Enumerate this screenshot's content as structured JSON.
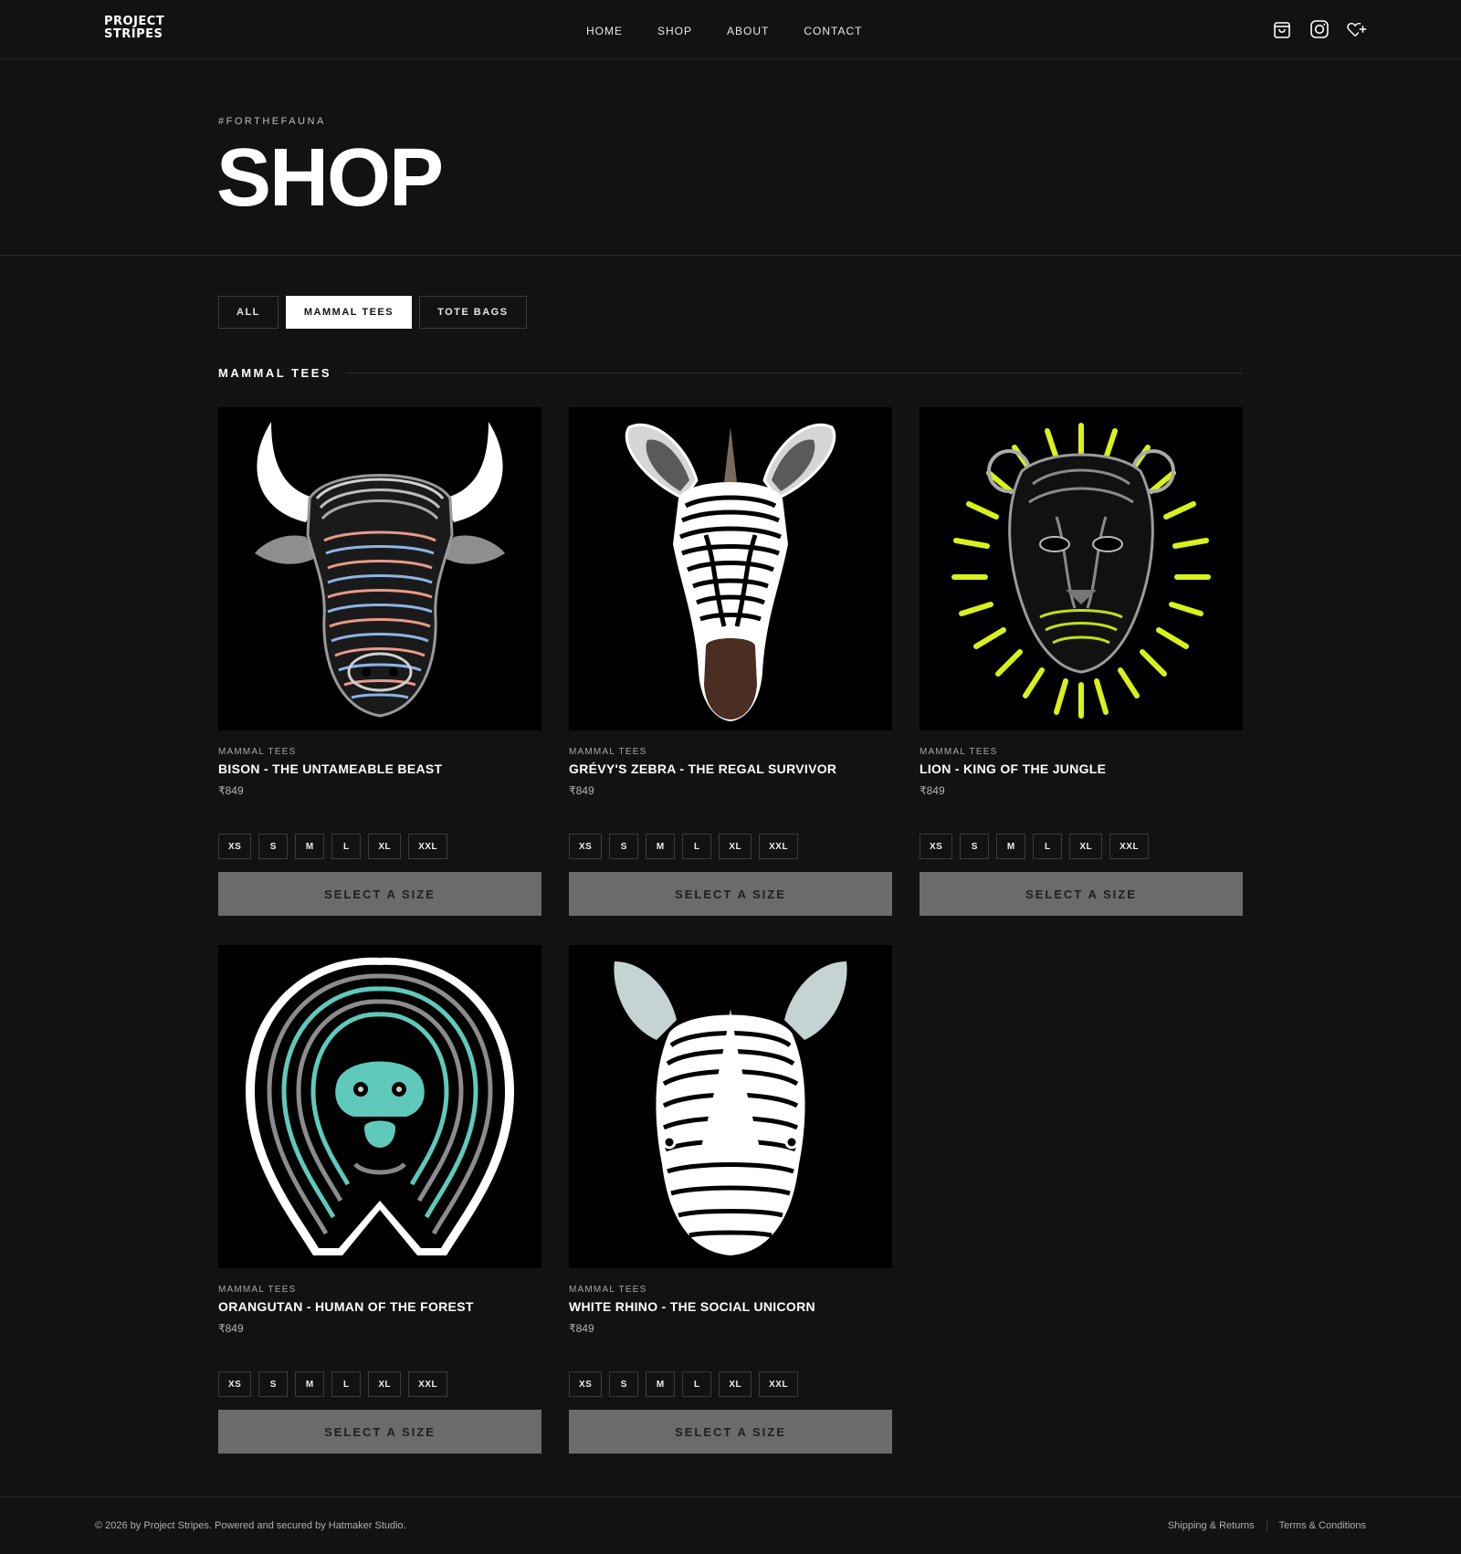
{
  "brand": {
    "logo_line1": "PROJECT",
    "logo_line2": "STRIPES"
  },
  "nav": [
    "HOME",
    "SHOP",
    "ABOUT",
    "CONTACT"
  ],
  "header_icons": [
    "shopping-bag-icon",
    "instagram-icon",
    "heart-plus-icon"
  ],
  "hero": {
    "hashtag": "#FORTHEFAUNA",
    "title": "SHOP"
  },
  "filters": [
    {
      "label": "ALL",
      "active": false
    },
    {
      "label": "MAMMAL TEES",
      "active": true
    },
    {
      "label": "TOTE BAGS",
      "active": false
    }
  ],
  "section": {
    "title": "MAMMAL TEES"
  },
  "sizes": [
    "XS",
    "S",
    "M",
    "L",
    "XL",
    "XXL"
  ],
  "products": [
    {
      "category": "MAMMAL TEES",
      "name": "BISON - THE UNTAMEABLE BEAST",
      "price": "₹849",
      "cta": "SELECT A SIZE",
      "image": "bison-artwork"
    },
    {
      "category": "MAMMAL TEES",
      "name": "GRÉVY'S ZEBRA - THE REGAL SURVIVOR",
      "price": "₹849",
      "cta": "SELECT A SIZE",
      "image": "zebra-artwork"
    },
    {
      "category": "MAMMAL TEES",
      "name": "LION - KING OF THE JUNGLE",
      "price": "₹849",
      "cta": "SELECT A SIZE",
      "image": "lion-artwork"
    },
    {
      "category": "MAMMAL TEES",
      "name": "ORANGUTAN - HUMAN OF THE FOREST",
      "price": "₹849",
      "cta": "SELECT A SIZE",
      "image": "orangutan-artwork"
    },
    {
      "category": "MAMMAL TEES",
      "name": "WHITE RHINO - THE SOCIAL UNICORN",
      "price": "₹849",
      "cta": "SELECT A SIZE",
      "image": "rhino-artwork"
    }
  ],
  "footer": {
    "copyright": "© 2026 by Project Stripes. Powered and secured by Hatmaker Studio.",
    "links": [
      "Shipping & Returns",
      "Terms & Conditions"
    ]
  },
  "colors": {
    "background": "#121212",
    "cta": "#6b6b6b",
    "accent_lion": "#d8f21a",
    "accent_orangutan": "#5fc9bb"
  }
}
